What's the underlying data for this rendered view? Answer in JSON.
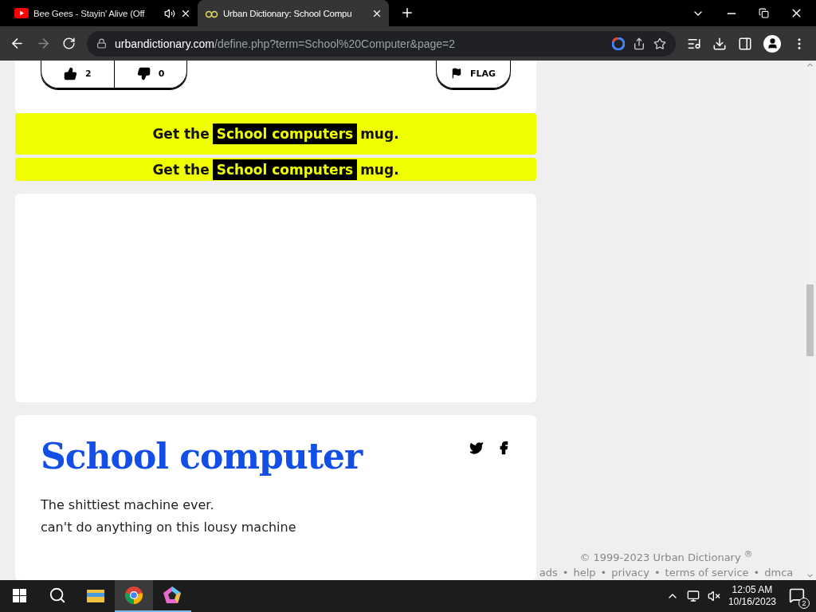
{
  "browser": {
    "tabs": [
      {
        "kind": "video",
        "title": "Bee Gees - Stayin' Alive (Off",
        "selected": false,
        "audio": true
      },
      {
        "kind": "dictionary",
        "title": "Urban Dictionary: School Compu",
        "selected": true,
        "audio": false
      }
    ],
    "url": {
      "domain": "urbandictionary.com",
      "path": "/define.php?term=School%20Computer&page=2"
    }
  },
  "votes": {
    "up": "2",
    "down": "0",
    "flag": "FLAG"
  },
  "banners": [
    {
      "kind": "full",
      "before": "Get the",
      "highlight": "School computers",
      "after": "mug."
    },
    {
      "kind": "clipped",
      "before": "Get the",
      "highlight": "School computers",
      "after": "mug."
    }
  ],
  "definition": {
    "word": "School computer",
    "lines": [
      "The shittiest machine ever.",
      "can't do anything on this lousy machine"
    ]
  },
  "footer": {
    "copyright": "© 1999-2023 Urban Dictionary $^{®}$",
    "separator": "•",
    "links": [
      "ads",
      "help",
      "privacy",
      "terms of service",
      "dmca"
    ]
  },
  "taskbar": {
    "apps": [
      {
        "kind": "explorer",
        "running": false,
        "selected": false
      },
      {
        "kind": "chrome",
        "running": true,
        "selected": true
      },
      {
        "kind": "pentagon",
        "running": true,
        "selected": false
      }
    ],
    "time": "12:05 AM",
    "date": "10/16/2023",
    "notifications": "2"
  }
}
